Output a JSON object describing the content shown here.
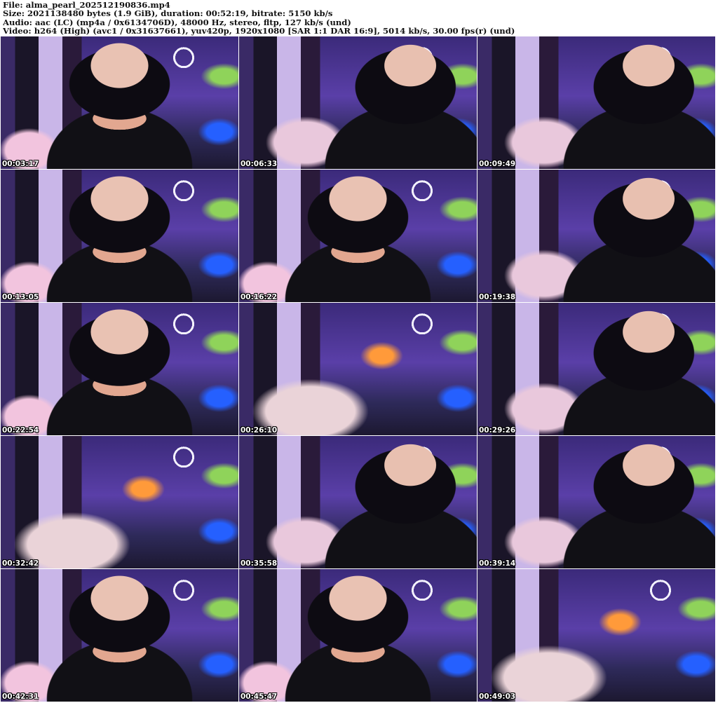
{
  "header": {
    "file": "File: alma_pearl_202512190836.mp4",
    "size": "Size: 2021138480 bytes (1.9 GiB), duration: 00:52:19, bitrate: 5150 kb/s",
    "audio": "Audio: aac (LC) (mp4a / 0x6134706D), 48000 Hz, stereo, fltp, 127 kb/s (und)",
    "video": "Video: h264 (High) (avc1 / 0x31637661), yuv420p, 1920x1080 [SAR 1:1 DAR 16:9], 5014 kb/s, 30.00 fps(r) (und)"
  },
  "thumbnails": [
    {
      "timestamp": "00:03:17"
    },
    {
      "timestamp": "00:06:33"
    },
    {
      "timestamp": "00:09:49"
    },
    {
      "timestamp": "00:13:05"
    },
    {
      "timestamp": "00:16:22"
    },
    {
      "timestamp": "00:19:38"
    },
    {
      "timestamp": "00:22:54"
    },
    {
      "timestamp": "00:26:10"
    },
    {
      "timestamp": "00:29:26"
    },
    {
      "timestamp": "00:32:42"
    },
    {
      "timestamp": "00:35:58"
    },
    {
      "timestamp": "00:39:14"
    },
    {
      "timestamp": "00:42:31"
    },
    {
      "timestamp": "00:45:47"
    },
    {
      "timestamp": "00:49:03"
    }
  ]
}
